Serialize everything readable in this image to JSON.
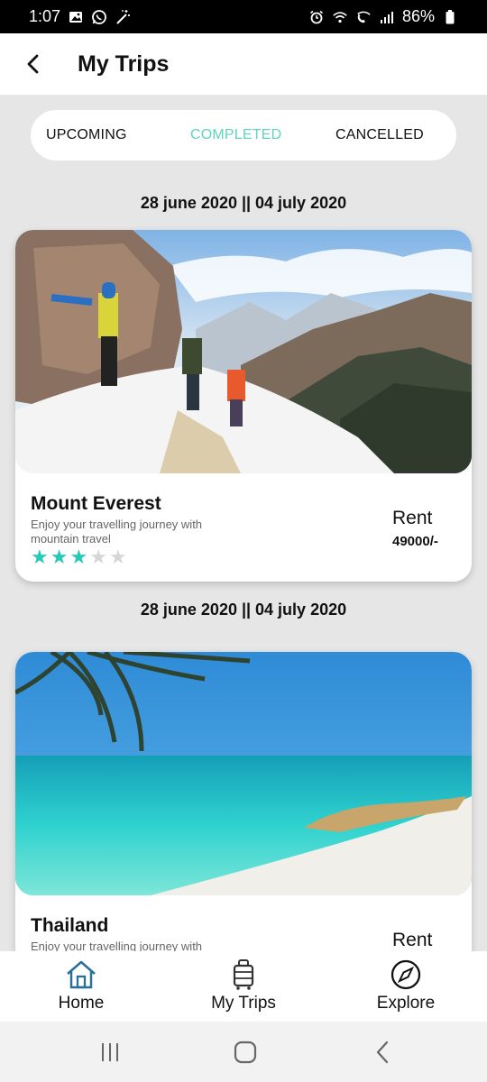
{
  "status_bar": {
    "time": "1:07",
    "battery": "86%",
    "left_icons": [
      "gallery-icon",
      "whatsapp-icon",
      "magic-icon"
    ],
    "right_icons": [
      "alarm-icon",
      "wifi-icon",
      "wifi-call-icon",
      "signal-icon",
      "battery-icon"
    ]
  },
  "header": {
    "title": "My Trips",
    "back_icon": "back-arrow-icon"
  },
  "tabs": [
    {
      "label": "UPCOMING",
      "active": false
    },
    {
      "label": "COMPLETED",
      "active": true
    },
    {
      "label": "CANCELLED",
      "active": false
    }
  ],
  "colors": {
    "accent": "#5fd3c0",
    "star_filled": "#27c9b7",
    "star_empty": "#d6d6d6",
    "background": "#e6e6e6"
  },
  "trips": [
    {
      "dates": "28 june 2020 || 04 july 2020",
      "name": "Mount Everest",
      "description": "Enjoy your travelling journey with mountain travel",
      "rating": 3,
      "rating_max": 5,
      "rent_label": "Rent",
      "price": "49000/-",
      "image": "mountain-hikers-photo"
    },
    {
      "dates": "28 june 2020 || 04 july 2020",
      "name": "Thailand",
      "description": "Enjoy your travelling journey with",
      "rent_label": "Rent",
      "image": "tropical-beach-photo"
    }
  ],
  "bottom_nav": [
    {
      "label": "Home",
      "icon": "home-icon"
    },
    {
      "label": "My Trips",
      "icon": "luggage-icon"
    },
    {
      "label": "Explore",
      "icon": "compass-icon"
    }
  ],
  "system_nav": [
    "recents-icon",
    "home-button-icon",
    "system-back-icon"
  ]
}
